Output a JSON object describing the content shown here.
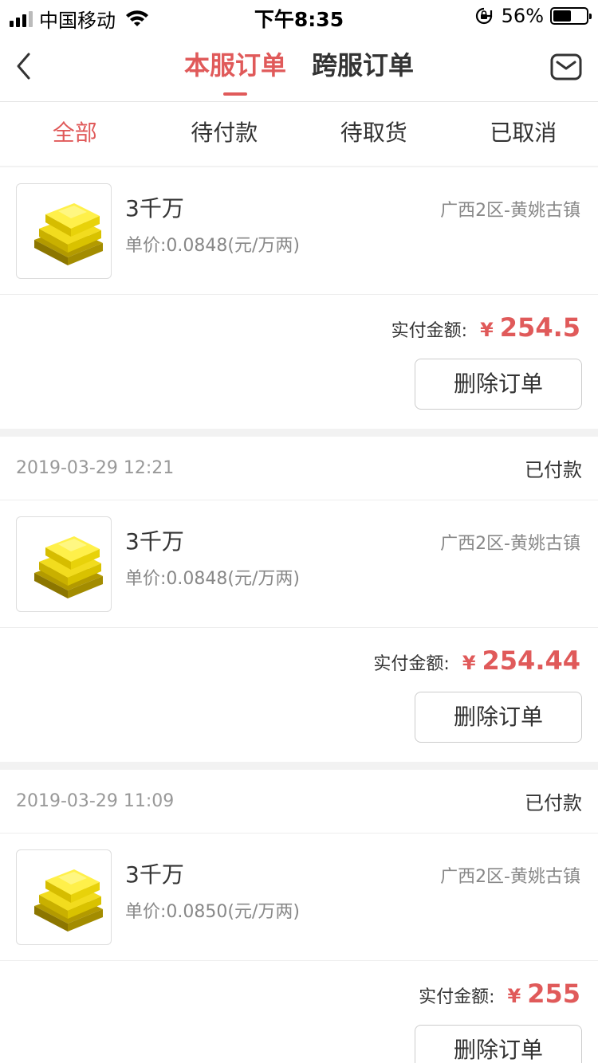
{
  "status_bar": {
    "carrier": "中国移动",
    "time": "下午8:35",
    "battery": "56%",
    "battery_level": 0.56
  },
  "nav": {
    "tabs": [
      {
        "label": "本服订单"
      },
      {
        "label": "跨服订单"
      }
    ]
  },
  "filter": {
    "tabs": [
      {
        "label": "全部"
      },
      {
        "label": "待付款"
      },
      {
        "label": "待取货"
      },
      {
        "label": "已取消"
      }
    ]
  },
  "orders": [
    {
      "date": "",
      "status": "",
      "item_name": "3千万",
      "unit_price": "单价:0.0848(元/万两)",
      "server": "广西2区-黄姚古镇",
      "paid_label": "实付金额:",
      "currency": "¥",
      "amount": "254.5",
      "delete_label": "删除订单"
    },
    {
      "date": "2019-03-29 12:21",
      "status": "已付款",
      "item_name": "3千万",
      "unit_price": "单价:0.0848(元/万两)",
      "server": "广西2区-黄姚古镇",
      "paid_label": "实付金额:",
      "currency": "¥",
      "amount": "254.44",
      "delete_label": "删除订单"
    },
    {
      "date": "2019-03-29 11:09",
      "status": "已付款",
      "item_name": "3千万",
      "unit_price": "单价:0.0850(元/万两)",
      "server": "广西2区-黄姚古镇",
      "paid_label": "实付金额:",
      "currency": "¥",
      "amount": "255",
      "delete_label": "删除订单"
    }
  ],
  "colors": {
    "accent": "#e05a5a",
    "background": "#f2f2f2",
    "card": "#ffffff"
  },
  "icons": {
    "back": "chevron-left-icon",
    "mail": "mail-icon",
    "item": "gold-ingot-icon"
  }
}
